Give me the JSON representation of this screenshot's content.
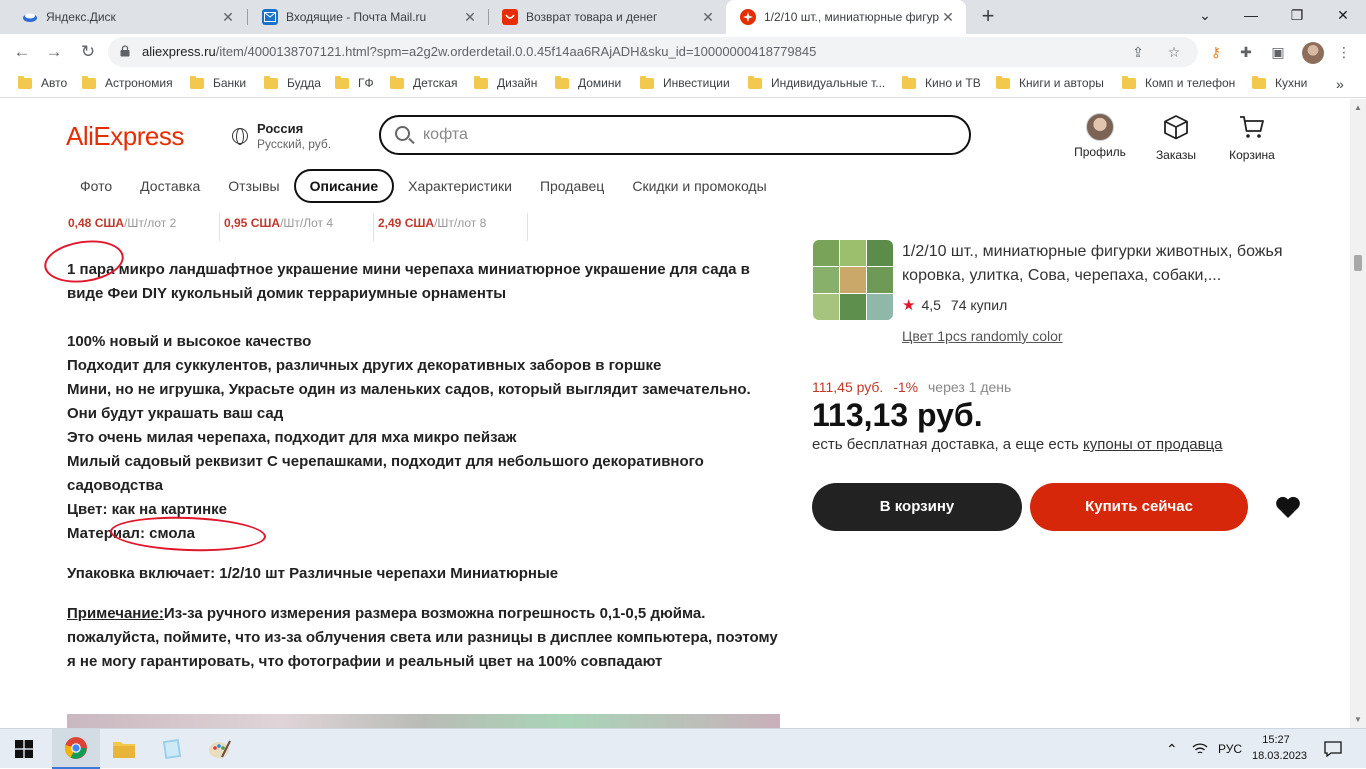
{
  "browser": {
    "tabs": [
      {
        "title": "Яндекс.Диск",
        "icon": "yandex-disk-icon",
        "color": "#2f6bd6"
      },
      {
        "title": "Входящие - Почта Mail.ru",
        "icon": "mail-icon",
        "color": "#1a73c9"
      },
      {
        "title": "Возврат товара и денег",
        "icon": "aliexpress-icon",
        "color": "#e62e04"
      },
      {
        "title": "1/2/10 шт., миниатюрные фигур",
        "icon": "aliexpress-icon",
        "color": "#e62e04"
      }
    ],
    "url_main": "aliexpress.ru",
    "url_rest": "/item/4000138707121.html?spm=a2g2w.orderdetail.0.0.45f14aa6RAjADH&sku_id=10000000418779845",
    "bookmarks": [
      "Авто",
      "Астрономия",
      "Банки",
      "Будда",
      "ГФ",
      "Детская",
      "Дизайн",
      "Домини",
      "Инвестиции",
      "Индивидуальные т...",
      "Кино и ТВ",
      "Книги и авторы",
      "Комп и телефон",
      "Кухни"
    ]
  },
  "header": {
    "logo": "AliExpress",
    "region_country": "Россия",
    "region_locale": "Русский, руб.",
    "search_value": "кофта",
    "actions": [
      "Профиль",
      "Заказы",
      "Корзина"
    ]
  },
  "nav": [
    "Фото",
    "Доставка",
    "Отзывы",
    "Описание",
    "Характеристики",
    "Продавец",
    "Скидки и промокоды"
  ],
  "tiers": [
    {
      "price": "0,48 США",
      "unit": "/Шт/лот 2"
    },
    {
      "price": "0,95 США",
      "unit": "/Шт/Лот 4"
    },
    {
      "price": "2,49 США",
      "unit": "/Шт/лот 8"
    }
  ],
  "description": {
    "title_part1": "1 пара",
    "title_part2": " микро ландшафтное украшение мини черепаха миниатюрное украшение для сада в виде Феи DIY кукольный домик террариумные орнаменты",
    "lines": [
      "100% новый и высокое качество",
      "Подходит для суккулентов, различных других декоративных заборов в горшке",
      "Мини, но не игрушка, Украсьте один из маленьких садов, который выглядит замечательно.",
      "Они будут украшать ваш сад",
      "Это очень милая черепаха, подходит для мха микро пейзаж",
      "Милый садовый реквизит С черепашками, подходит для небольшого декоративного садоводства"
    ],
    "color_label": "Цвет:",
    "color_value": " как на картинке",
    "material": "Материал: смола",
    "package": "Упаковка включает: 1/2/10 шт Различные черепахи Миниатюрные",
    "note_label": "Примечание:",
    "note_text": "Из-за ручного измерения размера возможна погрешность 0,1-0,5 дюйма. пожалуйста, поймите, что из-за облучения света или разницы в дисплее компьютера, поэтому я не могу гарантировать, что фотографии и реальный цвет на 100% совпадают"
  },
  "product": {
    "title": "1/2/10 шт., миниатюрные фигурки животных, божья коровка, улитка, Сова, черепаха, собаки,...",
    "rating": "4,5",
    "sold": "74 купил",
    "color_option": "Цвет 1pcs randomly color",
    "old_price": "111,45 руб.",
    "discount": "-1%",
    "price_later": "через 1 день",
    "price": "113,13 руб.",
    "shipping_text": "есть бесплатная доставка, а еще есть ",
    "shipping_link": "купоны от продавца",
    "cart_button": "В корзину",
    "buy_button": "Купить сейчас"
  },
  "taskbar": {
    "lang": "РУС",
    "time": "15:27",
    "date": "18.03.2023"
  },
  "colors": {
    "accent_red": "#e62e04",
    "buy_button": "#d6270b",
    "annotation_circle": "#e0162b"
  }
}
